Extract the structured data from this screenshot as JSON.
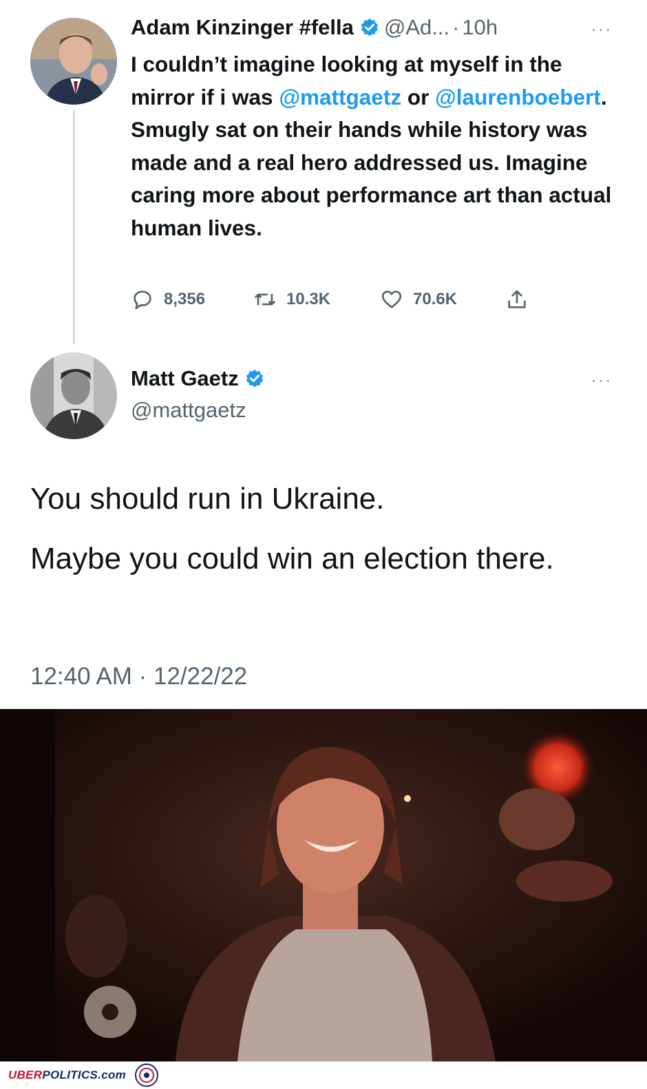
{
  "tweet1": {
    "display_name": "Adam Kinzinger #fella",
    "handle": "@Ad...",
    "time": "10h",
    "body_segments": [
      "I couldn’t imagine looking at myself in the mirror if i was ",
      "@mattgaetz",
      " or ",
      "@laurenboebert",
      ".  Smugly sat on their hands while history was made and a real hero addressed us.  Imagine caring more about performance art than actual human lives."
    ],
    "replies": "8,356",
    "retweets": "10.3K",
    "likes": "70.6K"
  },
  "tweet2": {
    "display_name": "Matt Gaetz",
    "handle": "@mattgaetz",
    "paragraphs": [
      "You should run in Ukraine.",
      "Maybe you could win an election there."
    ],
    "timestamp": "12:40 AM · 12/22/22"
  },
  "footer": {
    "brand_prefix": "UBER",
    "brand_suffix": "POLITICS.com"
  },
  "icons": {
    "verified": "verified-badge-icon",
    "reply": "reply-icon",
    "retweet": "retweet-icon",
    "like": "heart-icon",
    "share": "share-icon",
    "more": "more-options-icon"
  },
  "colors": {
    "mention": "#1d9bf0",
    "secondary_text": "#536471",
    "brand_red": "#c8102e",
    "brand_blue": "#0f2a6b"
  }
}
